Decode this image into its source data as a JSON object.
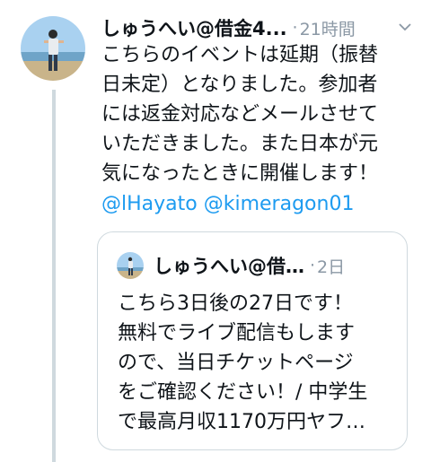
{
  "tweet": {
    "author_name": "しゅうへい@借金4...",
    "separator": "·",
    "time": "21時間",
    "text_lines": [
      "こちらのイベントは延期（振替",
      "日未定）となりました。参加者",
      "には返金対応などメールさせて",
      "いただきました。また日本が元",
      "気になったときに開催します！"
    ],
    "mentions": [
      "@lHayato",
      "@kimeragon01"
    ]
  },
  "quoted_tweet": {
    "author_name": "しゅうへい@借…",
    "separator": "·",
    "time": "2日",
    "text_lines": [
      "こちら3日後の27日です！",
      "無料でライブ配信もします",
      "ので、当日チケットページ",
      "をご確認ください！/ 中学生",
      "で最高月収1170万円ヤフ…"
    ]
  },
  "colors": {
    "link": "#1d9bf0",
    "muted": "#8b98a5",
    "border": "#cfd9de"
  },
  "icons": {
    "more": "chevron-down-icon"
  }
}
